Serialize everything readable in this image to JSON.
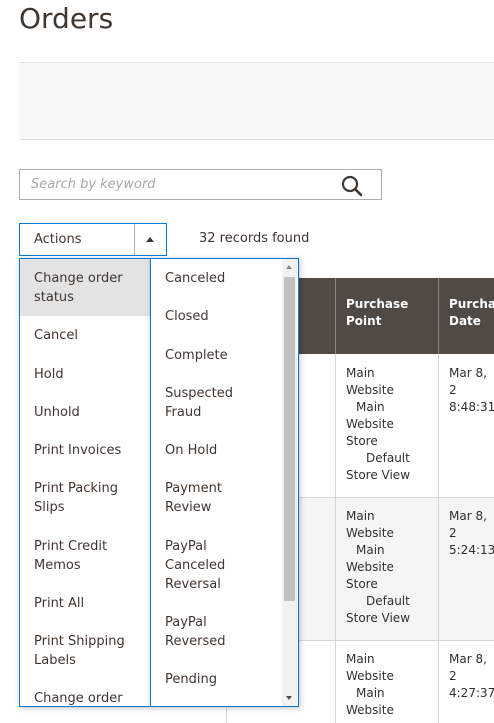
{
  "page": {
    "title": "Orders"
  },
  "search": {
    "placeholder": "Search by keyword",
    "value": ""
  },
  "toolbar": {
    "actions_label": "Actions",
    "records_found": "32 records found"
  },
  "grid": {
    "columns": [
      "Purchase Point",
      "Purchas Date"
    ],
    "rows": [
      {
        "purchase_point": [
          "Main",
          "Website",
          "Main",
          "Website",
          "Store",
          "Default",
          "Store View"
        ],
        "date": [
          "Mar 8, 2",
          "8:48:31"
        ]
      },
      {
        "purchase_point": [
          "Main",
          "Website",
          "Main",
          "Website",
          "Store",
          "Default",
          "Store View"
        ],
        "date": [
          "Mar 8, 2",
          "5:24:13"
        ]
      },
      {
        "purchase_point": [
          "Main",
          "Website",
          "Main",
          "Website"
        ],
        "date": [
          "Mar 8, 2",
          "4:27:37"
        ]
      }
    ]
  },
  "actions_menu": {
    "items": [
      [
        "Change order",
        "status"
      ],
      [
        "Cancel"
      ],
      [
        "Hold"
      ],
      [
        "Unhold"
      ],
      [
        "Print Invoices"
      ],
      [
        "Print Packing",
        "Slips"
      ],
      [
        "Print Credit",
        "Memos"
      ],
      [
        "Print All"
      ],
      [
        "Print Shipping",
        "Labels"
      ],
      [
        "Change order"
      ]
    ],
    "status_options": [
      [
        "Canceled"
      ],
      [
        "Closed"
      ],
      [
        "Complete"
      ],
      [
        "Suspected",
        "Fraud"
      ],
      [
        "On Hold"
      ],
      [
        "Payment",
        "Review"
      ],
      [
        "PayPal",
        "Canceled",
        "Reversal"
      ],
      [
        "PayPal",
        "Reversed"
      ],
      [
        "Pending"
      ]
    ]
  },
  "icons": {
    "search": "search-icon",
    "toggle": "caret-up-icon"
  }
}
